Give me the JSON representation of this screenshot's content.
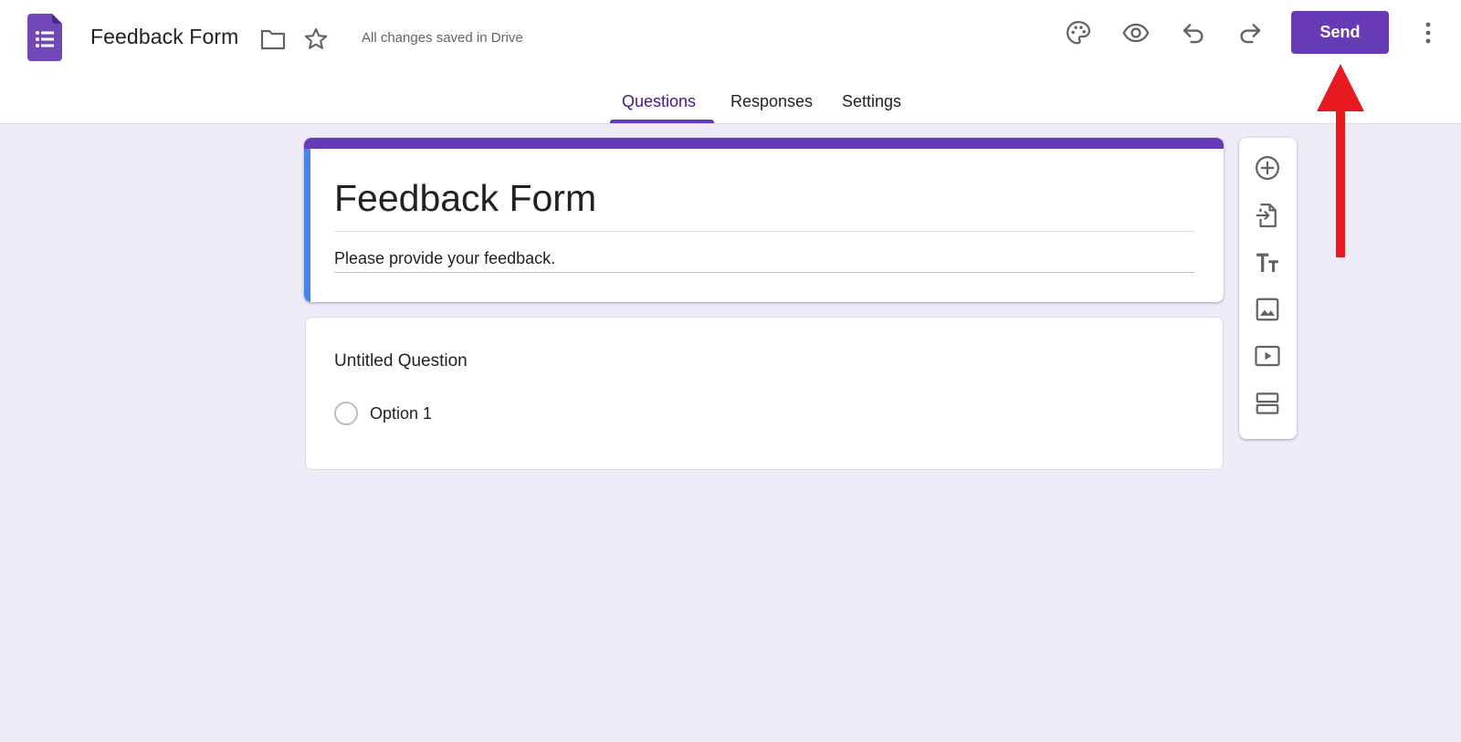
{
  "header": {
    "doc_title": "Feedback Form",
    "save_status": "All changes saved in Drive",
    "send_label": "Send",
    "icons": {
      "logo": "google-forms-logo",
      "folder": "folder-icon",
      "star": "star-icon",
      "palette": "palette-icon",
      "preview": "eye-icon",
      "undo": "undo-icon",
      "redo": "redo-icon",
      "more": "more-vert-icon"
    }
  },
  "tabs": [
    {
      "label": "Questions",
      "active": true
    },
    {
      "label": "Responses",
      "active": false
    },
    {
      "label": "Settings",
      "active": false
    }
  ],
  "form": {
    "title": "Feedback Form",
    "description": "Please provide your feedback."
  },
  "question": {
    "title": "Untitled Question",
    "options": [
      "Option 1"
    ]
  },
  "toolbar": {
    "tools": [
      "add-question-icon",
      "import-questions-icon",
      "add-title-icon",
      "add-image-icon",
      "add-video-icon",
      "add-section-icon"
    ]
  },
  "colors": {
    "accent": "#673ab7",
    "background": "#efebf9",
    "title_left_bar": "#4285f4",
    "annotation": "#e8191e"
  }
}
